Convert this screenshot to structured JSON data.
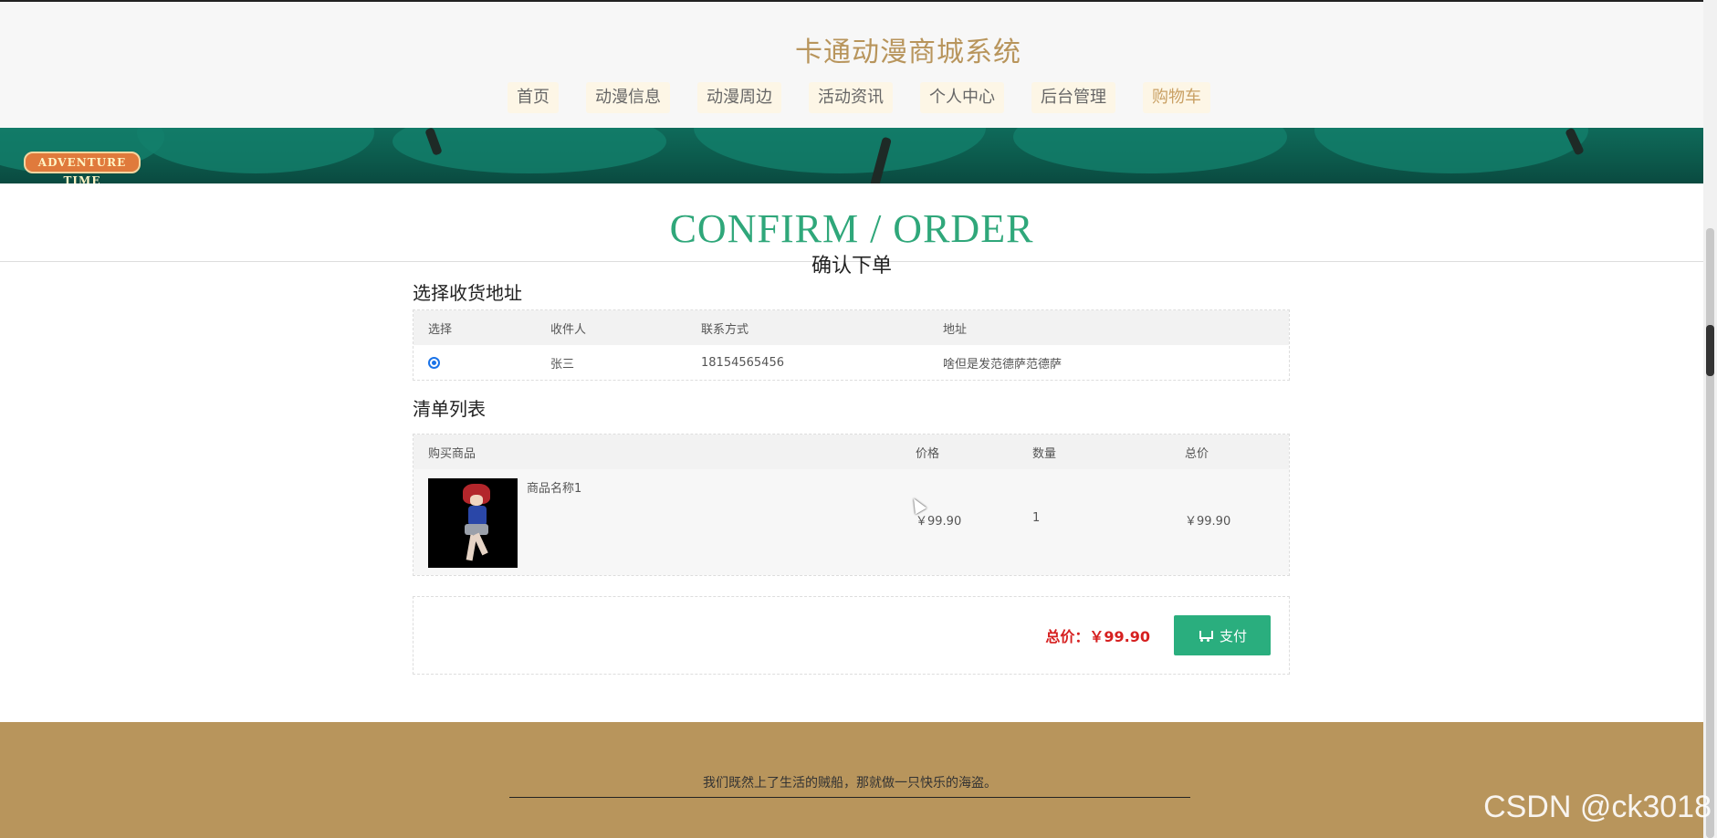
{
  "header": {
    "site_title": "卡通动漫商城系统",
    "nav": [
      "首页",
      "动漫信息",
      "动漫周边",
      "活动资讯",
      "个人中心",
      "后台管理",
      "购物车"
    ]
  },
  "banner": {
    "logo_text": "ADVENTURE TIME"
  },
  "title": {
    "en": "CONFIRM / ORDER",
    "cn": "确认下单"
  },
  "address_section": {
    "label": "选择收货地址",
    "headers": [
      "选择",
      "收件人",
      "联系方式",
      "地址"
    ],
    "rows": [
      {
        "selected": true,
        "recipient": "张三",
        "phone": "18154565456",
        "address": "啥但是发范德萨范德萨"
      }
    ]
  },
  "items_section": {
    "label": "清单列表",
    "headers": [
      "购买商品",
      "价格",
      "数量",
      "总价"
    ],
    "rows": [
      {
        "name": "商品名称1",
        "price": "￥99.90",
        "qty": "1",
        "total": "￥99.90"
      }
    ]
  },
  "summary": {
    "total_label": "总价：",
    "total_value": "￥99.90",
    "pay_label": "支付"
  },
  "footer": {
    "text": "我们既然上了生活的贼船，那就做一只快乐的海盗。"
  },
  "watermark": "CSDN @ck3018",
  "colors": {
    "accent": "#2fa77a",
    "brand": "#b8955c",
    "price": "#d62020"
  }
}
